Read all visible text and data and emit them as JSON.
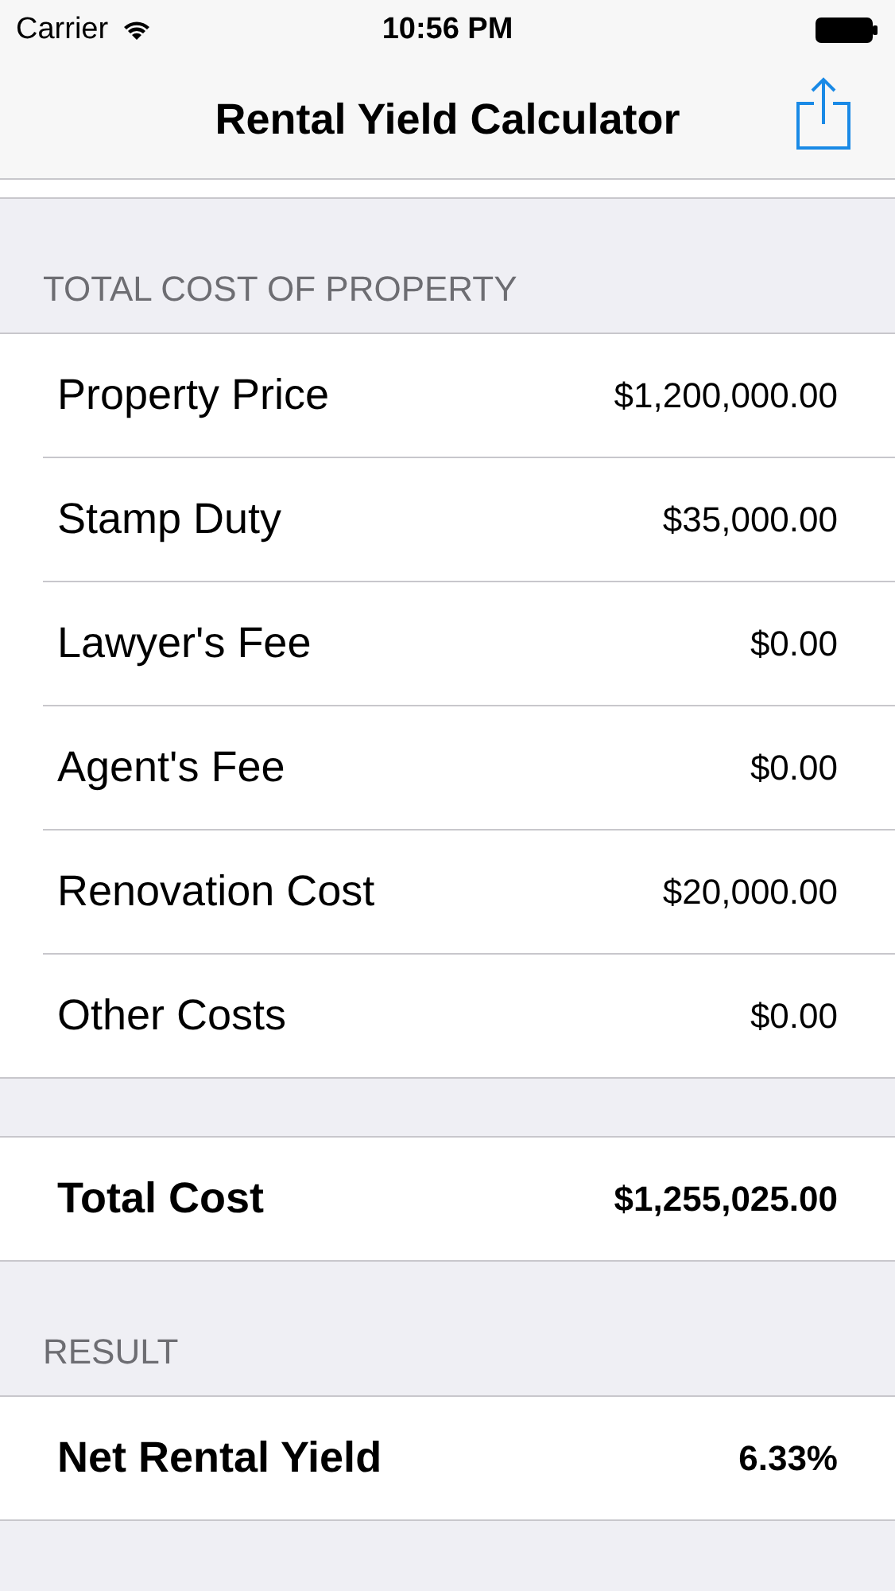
{
  "status_bar": {
    "carrier": "Carrier",
    "time": "10:56 PM"
  },
  "nav_bar": {
    "title": "Rental Yield Calculator"
  },
  "sections": [
    {
      "header": "TOTAL COST OF PROPERTY",
      "rows": [
        {
          "kind": "input",
          "label": "Property Price",
          "value": "$1,200,000.00"
        },
        {
          "kind": "input",
          "label": "Stamp Duty",
          "value": "$35,000.00"
        },
        {
          "kind": "input",
          "label": "Lawyer's Fee",
          "value": "$0.00"
        },
        {
          "kind": "input",
          "label": "Agent's Fee",
          "value": "$0.00"
        },
        {
          "kind": "input",
          "label": "Renovation Cost",
          "value": "$20,000.00"
        },
        {
          "kind": "input",
          "label": "Other Costs",
          "value": "$0.00"
        }
      ]
    },
    {
      "rows": [
        {
          "kind": "total",
          "label": "Total Cost",
          "value": "$1,255,025.00"
        }
      ]
    },
    {
      "header": "RESULT",
      "rows": [
        {
          "kind": "total",
          "label": "Net Rental Yield",
          "value": "6.33%"
        }
      ]
    }
  ]
}
